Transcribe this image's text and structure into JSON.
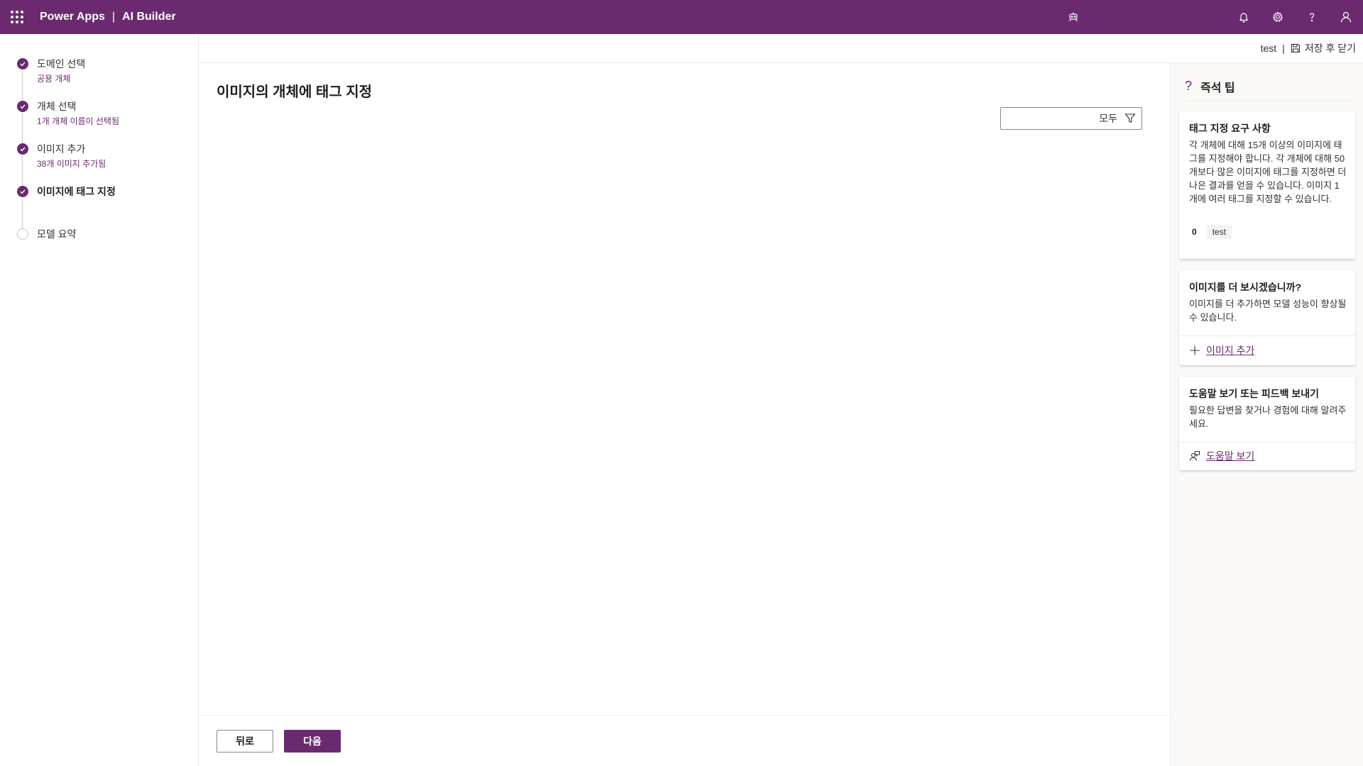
{
  "topbar": {
    "app_name": "Power Apps",
    "separator": "|",
    "product": "AI Builder",
    "icons": [
      "app-launcher-icon",
      "copilot-icon",
      "notification-icon",
      "settings-icon",
      "help-icon",
      "account-icon"
    ]
  },
  "colors": {
    "brand": "#6b2a70",
    "border": "#edebe9"
  },
  "steps": [
    {
      "title": "도메인 선택",
      "subtitle": "공용 개체",
      "state": "done"
    },
    {
      "title": "개체 선택",
      "subtitle": "1개 개체 이름이 선택됨",
      "state": "done"
    },
    {
      "title": "이미지 추가",
      "subtitle": "38개 이미지 추가됨",
      "state": "done"
    },
    {
      "title": "이미지에 태그 지정",
      "subtitle": "",
      "state": "current"
    },
    {
      "title": "모델 요약",
      "subtitle": "",
      "state": "pending"
    }
  ],
  "header_actions": {
    "model_name": "test",
    "divider": "|",
    "save_close_label": "저장 후 닫기"
  },
  "main": {
    "title": "이미지의 개체에 태그 지정",
    "filter_value": "모두"
  },
  "footer": {
    "back_label": "뒤로",
    "next_label": "다음"
  },
  "tips": {
    "header": "즉석 팁",
    "header_icon": "?",
    "cards": [
      {
        "title": "태그 지정 요구 사항",
        "body": "각 개체에 대해 15개 이상의 이미지에 태그를 지정해야 합니다. 각 개체에 대해 50개보다 많은 이미지에 태그를 지정하면 더 나은 결과를 얻을 수 있습니다. 이미지 1개에 여러 태그를 지정할 수 있습니다.",
        "tag_count": "0",
        "tag_name": "test"
      },
      {
        "title": "이미지를 더 보시겠습니까?",
        "body": "이미지를 더 추가하면 모델 성능이 향상될 수 있습니다.",
        "link": "이미지 추가"
      },
      {
        "title": "도움말 보기 또는 피드백 보내기",
        "body": "필요한 답변을 찾거나 경험에 대해 알려주세요.",
        "link": "도움말 보기"
      }
    ]
  }
}
